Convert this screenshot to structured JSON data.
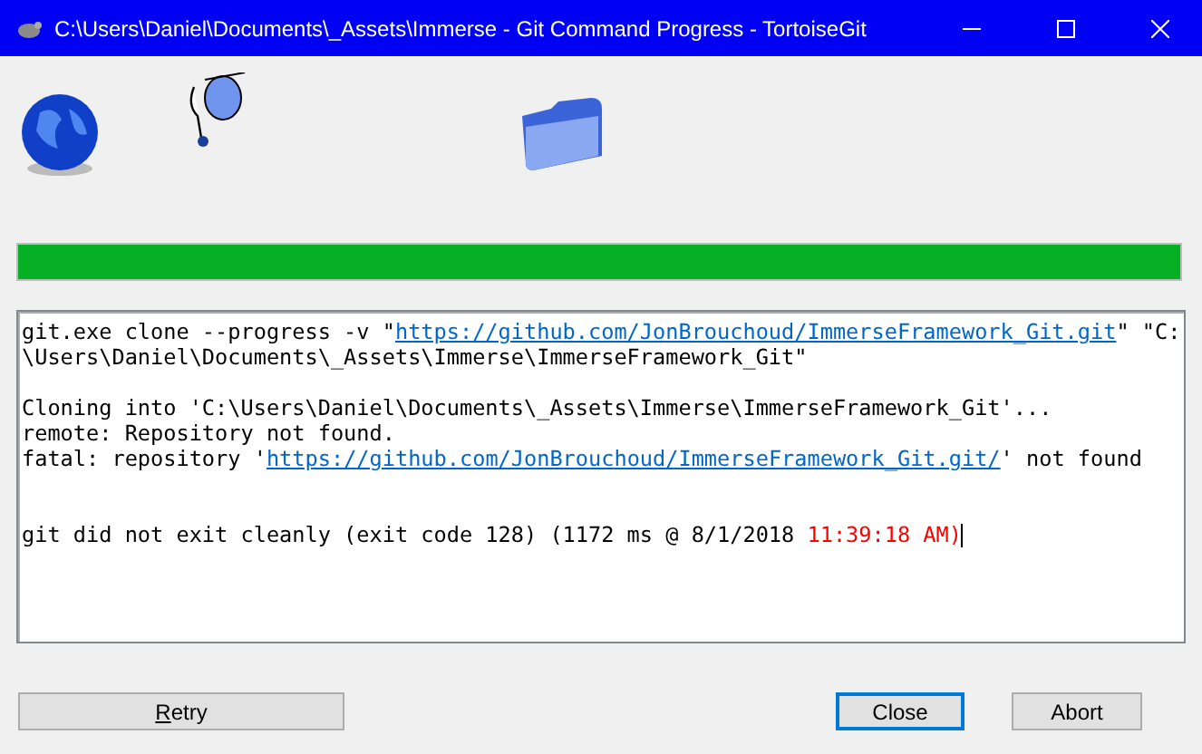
{
  "window": {
    "title": "C:\\Users\\Daniel\\Documents\\_Assets\\Immerse - Git Command Progress - TortoiseGit"
  },
  "progress": {
    "level": 1.0
  },
  "log": [
    {
      "kind": "text",
      "segments": [
        {
          "kind": "text",
          "text": "git.exe clone --progress -v \""
        },
        {
          "kind": "link",
          "text": "https://github.com/JonBrouchoud/ImmerseFramework_Git.git"
        },
        {
          "kind": "text",
          "text": "\" \"C:"
        }
      ]
    },
    {
      "kind": "text",
      "segments": [
        {
          "kind": "text",
          "text": "\\Users\\Daniel\\Documents\\_Assets\\Immerse\\ImmerseFramework_Git\""
        }
      ]
    },
    {
      "kind": "blank"
    },
    {
      "kind": "text",
      "segments": [
        {
          "kind": "text",
          "text": "Cloning into 'C:\\Users\\Daniel\\Documents\\_Assets\\Immerse\\ImmerseFramework_Git'..."
        }
      ]
    },
    {
      "kind": "text",
      "segments": [
        {
          "kind": "text",
          "text": "remote: Repository not found."
        }
      ]
    },
    {
      "kind": "text",
      "segments": [
        {
          "kind": "text",
          "text": "fatal: repository '"
        },
        {
          "kind": "link",
          "text": "https://github.com/JonBrouchoud/ImmerseFramework_Git.git/"
        },
        {
          "kind": "text",
          "text": "' not found"
        }
      ]
    },
    {
      "kind": "blank"
    },
    {
      "kind": "blank"
    },
    {
      "kind": "text",
      "segments": [
        {
          "kind": "text",
          "text": "git did not exit cleanly (exit code 128) (1172 ms @ 8/1/2018 "
        },
        {
          "kind": "error",
          "text": "11:39:18 AM)"
        }
      ]
    }
  ],
  "buttons": [
    {
      "label": "Retry",
      "mnemonic": true,
      "default": false
    },
    {
      "label": "Close",
      "mnemonic": false,
      "default": true
    },
    {
      "label": "Abort",
      "mnemonic": false,
      "default": false
    }
  ]
}
